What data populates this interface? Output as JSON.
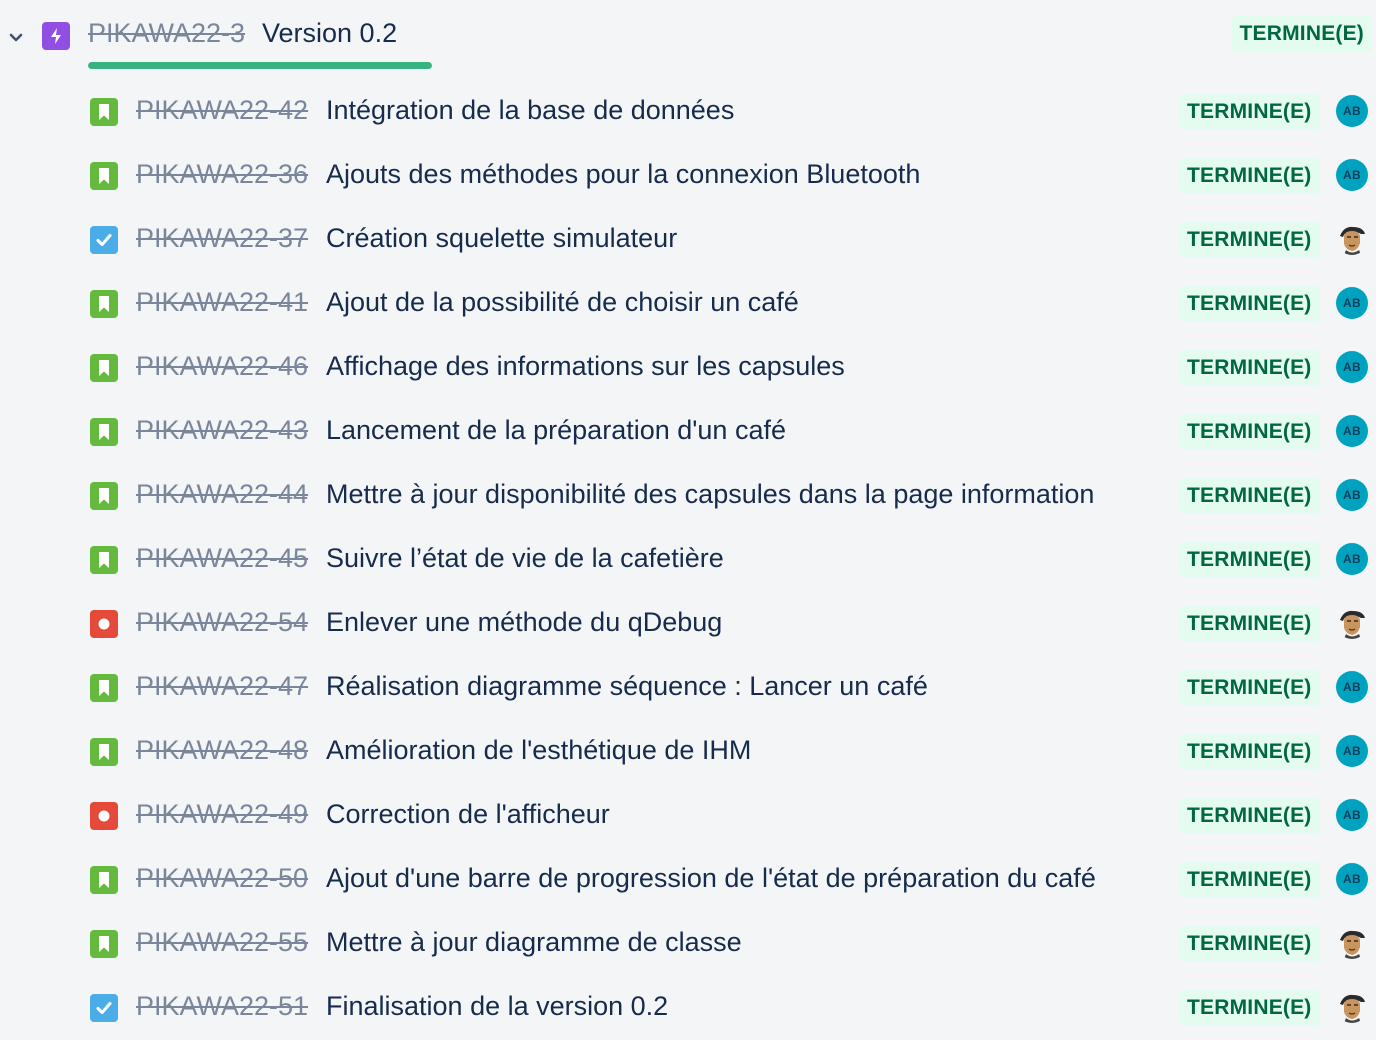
{
  "epic": {
    "key": "PIKAWA22-3",
    "title": "Version 0.2",
    "status": "TERMINE(E)",
    "progress": 1.0,
    "icon": "epic-lightning-icon",
    "expand_icon": "chevron-down-icon",
    "colors": {
      "epic": "#904ee2",
      "progress": "#36b37e",
      "status_bg": "#e3fcef",
      "status_text": "#006644"
    }
  },
  "issues": [
    {
      "type": "story",
      "key": "PIKAWA22-42",
      "summary": "Intégration de la base de données",
      "status": "TERMINE(E)",
      "assignee": "AB"
    },
    {
      "type": "story",
      "key": "PIKAWA22-36",
      "summary": "Ajouts des méthodes pour la connexion Bluetooth",
      "status": "TERMINE(E)",
      "assignee": "AB"
    },
    {
      "type": "task",
      "key": "PIKAWA22-37",
      "summary": "Création squelette simulateur",
      "status": "TERMINE(E)",
      "assignee": "photo"
    },
    {
      "type": "story",
      "key": "PIKAWA22-41",
      "summary": "Ajout de la possibilité de choisir un café",
      "status": "TERMINE(E)",
      "assignee": "AB"
    },
    {
      "type": "story",
      "key": "PIKAWA22-46",
      "summary": "Affichage des informations sur les capsules",
      "status": "TERMINE(E)",
      "assignee": "AB"
    },
    {
      "type": "story",
      "key": "PIKAWA22-43",
      "summary": "Lancement de la préparation d'un café",
      "status": "TERMINE(E)",
      "assignee": "AB"
    },
    {
      "type": "story",
      "key": "PIKAWA22-44",
      "summary": "Mettre à jour disponibilité des capsules dans la page information",
      "status": "TERMINE(E)",
      "assignee": "AB"
    },
    {
      "type": "story",
      "key": "PIKAWA22-45",
      "summary": "Suivre l’état de vie de la cafetière",
      "status": "TERMINE(E)",
      "assignee": "AB"
    },
    {
      "type": "bug",
      "key": "PIKAWA22-54",
      "summary": "Enlever une méthode du qDebug",
      "status": "TERMINE(E)",
      "assignee": "photo"
    },
    {
      "type": "story",
      "key": "PIKAWA22-47",
      "summary": "Réalisation diagramme séquence : Lancer un café",
      "status": "TERMINE(E)",
      "assignee": "AB"
    },
    {
      "type": "story",
      "key": "PIKAWA22-48",
      "summary": "Amélioration de l'esthétique de IHM",
      "status": "TERMINE(E)",
      "assignee": "AB"
    },
    {
      "type": "bug",
      "key": "PIKAWA22-49",
      "summary": "Correction de l'afficheur",
      "status": "TERMINE(E)",
      "assignee": "AB"
    },
    {
      "type": "story",
      "key": "PIKAWA22-50",
      "summary": "Ajout d'une barre de progression de l'état de préparation du café",
      "status": "TERMINE(E)",
      "assignee": "AB"
    },
    {
      "type": "story",
      "key": "PIKAWA22-55",
      "summary": "Mettre à jour diagramme de classe",
      "status": "TERMINE(E)",
      "assignee": "photo"
    },
    {
      "type": "task",
      "key": "PIKAWA22-51",
      "summary": "Finalisation de la version 0.2",
      "status": "TERMINE(E)",
      "assignee": "photo"
    }
  ],
  "type_icons": {
    "story": "story-bookmark-icon",
    "task": "task-checkbox-icon",
    "bug": "bug-dot-icon"
  }
}
